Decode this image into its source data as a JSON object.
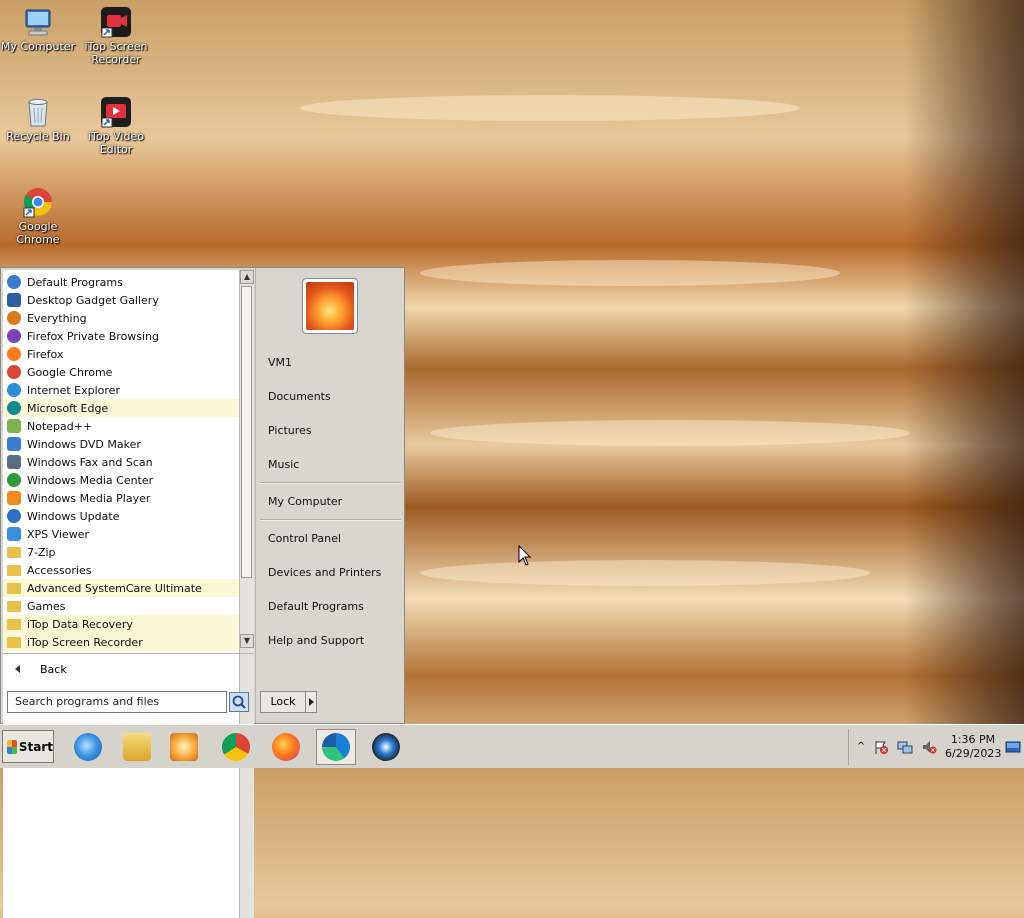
{
  "desktop": {
    "icons": [
      {
        "label": "My Computer",
        "icon": "computer-icon"
      },
      {
        "label": "iTop Screen Recorder",
        "icon": "screen-recorder-icon"
      },
      {
        "label": "Recycle Bin",
        "icon": "recycle-bin-icon"
      },
      {
        "label": "iTop Video Editor",
        "icon": "video-editor-icon"
      },
      {
        "label": "Google Chrome",
        "icon": "chrome-icon"
      }
    ]
  },
  "start_menu": {
    "programs": [
      {
        "label": "Default Programs",
        "icon": "default-programs-icon",
        "highlight": false
      },
      {
        "label": "Desktop Gadget Gallery",
        "icon": "gadget-icon",
        "highlight": false
      },
      {
        "label": "Everything",
        "icon": "magnifier-icon",
        "highlight": false
      },
      {
        "label": "Firefox Private Browsing",
        "icon": "firefox-private-icon",
        "highlight": false
      },
      {
        "label": "Firefox",
        "icon": "firefox-icon",
        "highlight": false
      },
      {
        "label": "Google Chrome",
        "icon": "chrome-icon",
        "highlight": false
      },
      {
        "label": "Internet Explorer",
        "icon": "ie-icon",
        "highlight": false
      },
      {
        "label": "Microsoft Edge",
        "icon": "edge-icon",
        "highlight": true
      },
      {
        "label": "Notepad++",
        "icon": "notepad-icon",
        "highlight": false
      },
      {
        "label": "Windows DVD Maker",
        "icon": "dvd-icon",
        "highlight": false
      },
      {
        "label": "Windows Fax and Scan",
        "icon": "fax-icon",
        "highlight": false
      },
      {
        "label": "Windows Media Center",
        "icon": "media-center-icon",
        "highlight": false
      },
      {
        "label": "Windows Media Player",
        "icon": "media-player-icon",
        "highlight": false
      },
      {
        "label": "Windows Update",
        "icon": "windows-update-icon",
        "highlight": false
      },
      {
        "label": "XPS Viewer",
        "icon": "xps-icon",
        "highlight": false
      },
      {
        "label": "7-Zip",
        "icon": "folder-icon",
        "highlight": false
      },
      {
        "label": "Accessories",
        "icon": "folder-icon",
        "highlight": false
      },
      {
        "label": "Advanced SystemCare Ultimate",
        "icon": "folder-icon",
        "highlight": true
      },
      {
        "label": "Games",
        "icon": "folder-icon",
        "highlight": false
      },
      {
        "label": "iTop Data Recovery",
        "icon": "folder-icon",
        "highlight": true
      },
      {
        "label": "iTop Screen Recorder",
        "icon": "folder-icon",
        "highlight": true
      }
    ],
    "back_label": "Back",
    "search_placeholder": "Search programs and files",
    "right_items": {
      "user": "VM1",
      "documents": "Documents",
      "pictures": "Pictures",
      "music": "Music",
      "my_computer": "My Computer",
      "control_panel": "Control Panel",
      "devices": "Devices and Printers",
      "default_programs": "Default Programs",
      "help": "Help and Support"
    },
    "lock_label": "Lock"
  },
  "taskbar": {
    "start_label": "Start",
    "pinned": [
      {
        "icon": "ie-icon",
        "active": false
      },
      {
        "icon": "explorer-folder-icon",
        "active": false
      },
      {
        "icon": "media-player-icon",
        "active": false
      },
      {
        "icon": "chrome-icon",
        "active": false
      },
      {
        "icon": "firefox-icon",
        "active": false
      },
      {
        "icon": "edge-icon",
        "active": true
      },
      {
        "icon": "itop-recorder-icon",
        "active": false
      }
    ],
    "clock_time": "1:36 PM",
    "clock_date": "6/29/2023"
  },
  "colors": {
    "menu_bg": "#d9d6cf",
    "highlight_row": "#fbf8d6",
    "taskbar_bg": "#d5d3cc"
  }
}
